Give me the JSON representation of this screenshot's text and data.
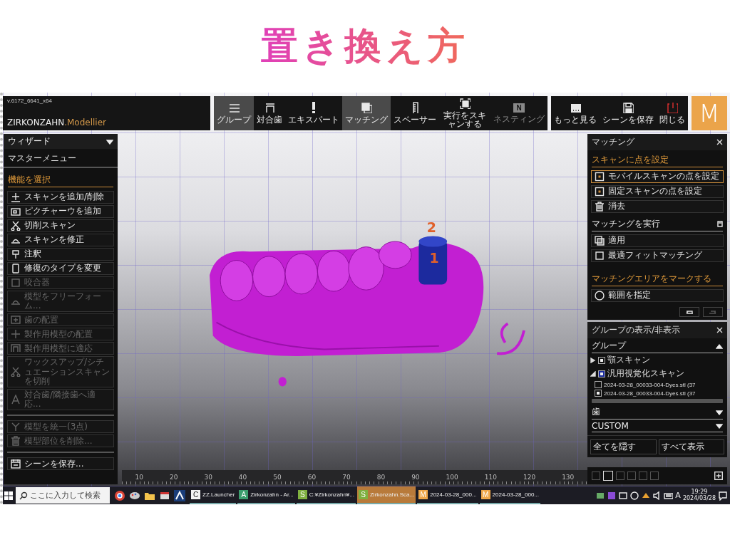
{
  "slide_title": "置き換え方",
  "app": {
    "version": "v.6172_6641_x64",
    "brand": "ZIRKONZAHN",
    "product": ".Modellier",
    "logo": "M"
  },
  "toolbar": [
    {
      "label": "グループ",
      "selected": true,
      "disabled": false
    },
    {
      "label": "対合歯",
      "selected": false,
      "disabled": false
    },
    {
      "label": "エキスパート",
      "selected": false,
      "disabled": false
    },
    {
      "label": "マッチング",
      "selected": true,
      "disabled": false
    },
    {
      "label": "スペーサー",
      "selected": false,
      "disabled": false
    },
    {
      "label": "実行をスキャンする",
      "selected": false,
      "disabled": false
    },
    {
      "label": "ネスティング",
      "icon_text": "N",
      "selected": false,
      "disabled": true
    }
  ],
  "toolbar_right": [
    {
      "label": "もっと見る"
    },
    {
      "label": "シーンを保存"
    },
    {
      "label": "閉じる"
    }
  ],
  "wizard": {
    "label": "ウィザード",
    "master_menu": "マスターメニュー",
    "section": "機能を選択",
    "groups": [
      [
        {
          "label": "スキャンを追加/削除",
          "disabled": false
        },
        {
          "label": "ピクチャーウを追加",
          "disabled": false
        },
        {
          "label": "切削スキャン",
          "disabled": false
        },
        {
          "label": "スキャンを修正",
          "disabled": false
        },
        {
          "label": "注釈",
          "disabled": false
        },
        {
          "label": "修復のタイプを変更",
          "disabled": false
        },
        {
          "label": "咬合器",
          "disabled": true
        },
        {
          "label": "模型をフリーフォーム...",
          "disabled": true
        },
        {
          "label": "歯の配置",
          "disabled": true
        },
        {
          "label": "製作用模型の配置",
          "disabled": true
        },
        {
          "label": "製作用模型に適応",
          "disabled": true
        },
        {
          "label": "ワックスアップ/シチュエーションスキャンを切削",
          "disabled": true
        },
        {
          "label": "対合歯/隣接歯へ適応...",
          "disabled": true
        }
      ],
      [
        {
          "label": "模型を統一(3点)",
          "disabled": true
        },
        {
          "label": "模型部位を削除...",
          "disabled": true
        }
      ],
      [
        {
          "label": "シーンを保存...",
          "disabled": false
        }
      ]
    ]
  },
  "matching": {
    "title": "マッチング",
    "sections": [
      {
        "heading": "スキャンに点を設定",
        "items": [
          {
            "label": "モバイルスキャンの点を設定",
            "selected": true
          },
          {
            "label": "固定スキャンの点を設定",
            "selected": false
          },
          {
            "label": "消去",
            "selected": false
          }
        ]
      },
      {
        "heading": "マッチングを実行",
        "items": [
          {
            "label": "適用",
            "selected": false
          },
          {
            "label": "最適フィットマッチング",
            "selected": false
          }
        ]
      },
      {
        "heading": "マッチングエリアをマークする",
        "items": [
          {
            "label": "範囲を指定",
            "selected": false
          }
        ]
      }
    ],
    "history_buttons": [
      {
        "disabled": false
      },
      {
        "disabled": true
      }
    ]
  },
  "groups": {
    "title": "グループの表示/非表示",
    "tree_heading": "グループ",
    "tree_expanded": true,
    "tree": [
      {
        "label": "顎スキャン",
        "checked": true,
        "expanded": false
      },
      {
        "label": "汎用視覚化スキャン",
        "checked": true,
        "expanded": true,
        "children": [
          {
            "label": "2024-03-28_00033-004-Dyes.stl (37",
            "checked": false
          },
          {
            "label": "2024-03-28_00033-004-Dyes.stl (37",
            "checked": true
          }
        ]
      }
    ],
    "dropdowns": [
      {
        "label": "歯",
        "expanded": false
      },
      {
        "label": "CUSTOM",
        "expanded": false
      }
    ],
    "buttons": [
      "全てを隠す",
      "すべて表示"
    ]
  },
  "views": [
    {
      "selected": false
    },
    {
      "selected": true
    },
    {
      "selected": false
    },
    {
      "selected": false
    },
    {
      "selected": false
    },
    {
      "selected": false
    }
  ],
  "model_markers": [
    "2",
    "1"
  ],
  "ruler": [
    "10",
    "20",
    "30",
    "40",
    "50",
    "60",
    "70",
    "80",
    "90",
    "100",
    "110",
    "120",
    "130"
  ],
  "taskbar": {
    "search_placeholder": "ここに入力して検索",
    "tasks": [
      {
        "badge": "C",
        "label": "ZZ.Launcher",
        "color": "#f2f2f2",
        "selected": false
      },
      {
        "badge": "A",
        "label": "Zirkonzahn - Ar...",
        "color": "#3c9e6e",
        "selected": false
      },
      {
        "badge": "S",
        "label": "C:¥Zirkonzahn¥...",
        "color": "#7fb040",
        "selected": false
      },
      {
        "badge": "S",
        "label": "Zirkonzahn.Sca...",
        "color": "#7fb040",
        "selected": true
      },
      {
        "badge": "M",
        "label": "2024-03-28_000...",
        "color": "#f0a84a",
        "selected": false
      },
      {
        "badge": "M",
        "label": "2024-03-28_000...",
        "color": "#f0a84a",
        "selected": false
      }
    ],
    "ime": "A",
    "time": "19:29",
    "date": "2024/03/28"
  }
}
